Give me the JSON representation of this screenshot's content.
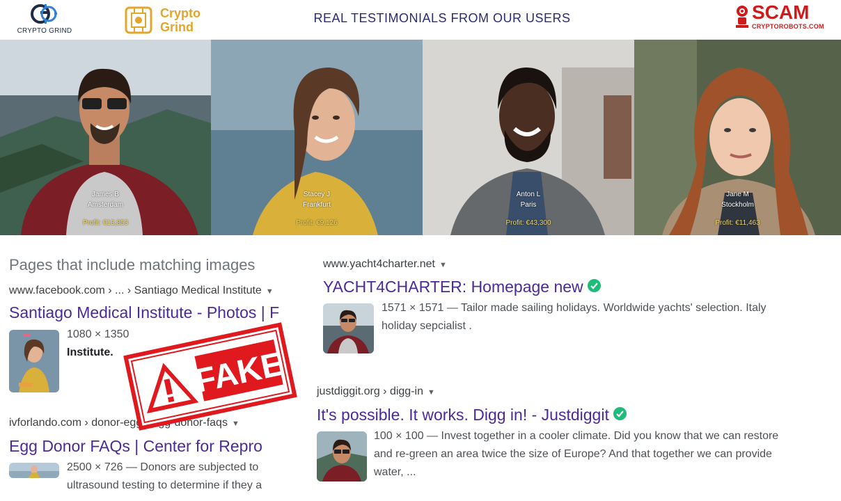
{
  "header": {
    "logo_left_text": "CRYPTO GRIND",
    "logo_mid_line1": "Crypto",
    "logo_mid_line2": "Grind",
    "title": "REAL TESTIMONIALS FROM OUR USERS",
    "scam_big": "SCAM",
    "scam_small": "CRYPTOROBOTS.COM"
  },
  "testimonials": [
    {
      "name": "James B",
      "city": "Amsterdam",
      "profit": "Profit: €13,853"
    },
    {
      "name": "Stacey J",
      "city": "Frankfurt",
      "profit": "Profit: €9,126"
    },
    {
      "name": "Anton L",
      "city": "Paris",
      "profit": "Profit: €43,300"
    },
    {
      "name": "Jane M",
      "city": "Stockholm",
      "profit": "Profit: €11,463"
    }
  ],
  "search": {
    "section_heading": "Pages that include matching images",
    "left_results": [
      {
        "breadcrumb": "www.facebook.com › ... › Santiago Medical Institute",
        "title": "Santiago Medical Institute - Photos | F",
        "dims": "1080 × 1350",
        "snippet_bold": "Institute."
      },
      {
        "breadcrumb": "ivforlando.com › donor-egg › egg-donor-faqs",
        "title": "Egg Donor FAQs | Center for Repro",
        "dims": "2500 × 726 — Donors are subjected to",
        "snippet": "ultrasound testing to determine if they a"
      }
    ],
    "right_results": [
      {
        "breadcrumb": "www.yacht4charter.net",
        "title": "YACHT4CHARTER: Homepage new",
        "line1": "1571 × 1571 — Tailor made sailing holidays. Worldwide yachts' selection. Italy",
        "line2": "holiday sepcialist ."
      },
      {
        "breadcrumb": "justdiggit.org › digg-in",
        "title": "It's possible. It works. Digg in! - Justdiggit",
        "line1": "100 × 100 — Invest together in a cooler climate. Did you know that we can restore",
        "line2": "and re-green an area twice the size of Europe? And that together we can provide",
        "line3": "water, ..."
      }
    ]
  },
  "stamp": {
    "text": "FAKE"
  },
  "colors": {
    "title_purple": "#4c2a99",
    "header_title": "#2b2b7a",
    "scam_red": "#d11b1b",
    "stamp_red": "#e0191f",
    "verified_green": "#1fbb7a",
    "profit_yellow": "#f2d86a"
  }
}
